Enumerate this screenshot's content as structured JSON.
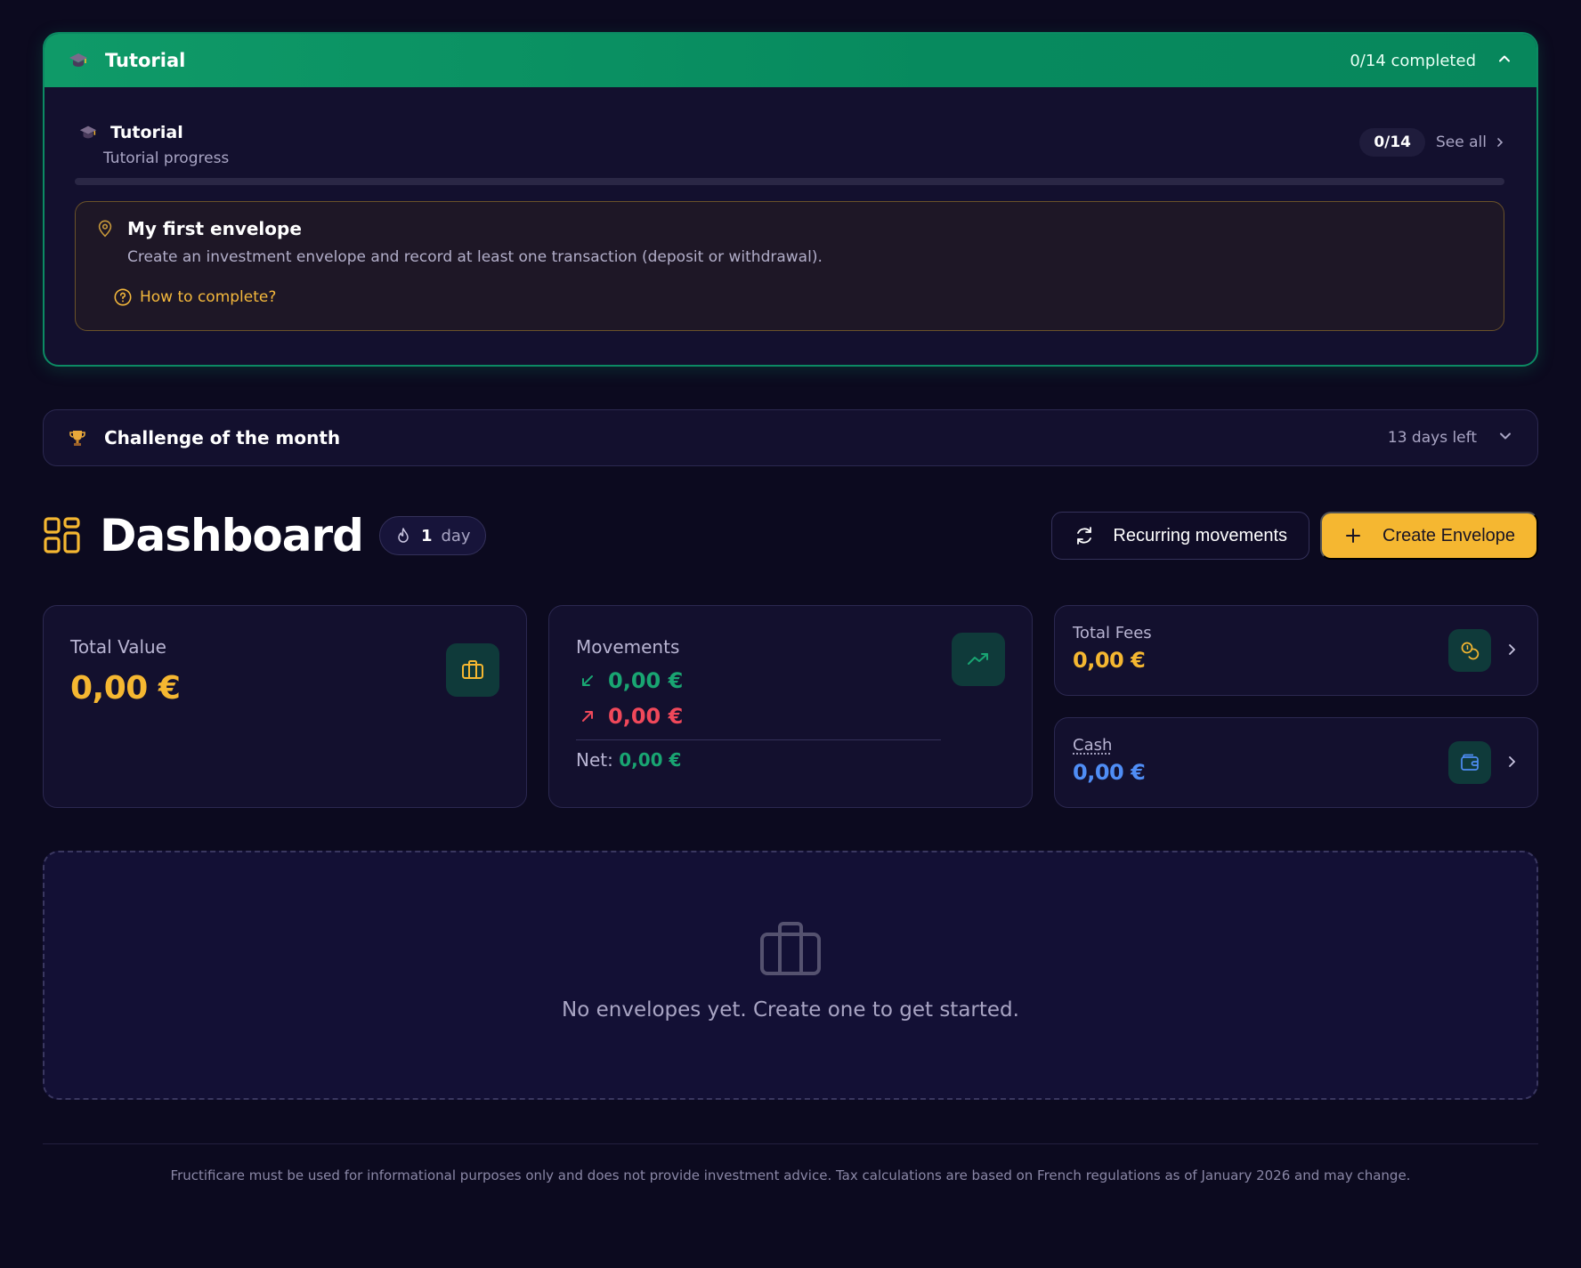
{
  "tutorial": {
    "header_title": "Tutorial",
    "header_count": "0/14 completed",
    "sub_title": "Tutorial",
    "sub_desc": "Tutorial progress",
    "count_pill": "0/14",
    "see_all": "See all",
    "progress": 0,
    "step": {
      "title": "My first envelope",
      "description": "Create an investment envelope and record at least one transaction (deposit or withdrawal).",
      "help_link": "How to complete?"
    }
  },
  "challenge": {
    "title": "Challenge of the month",
    "days_left": "13 days left"
  },
  "dashboard": {
    "title": "Dashboard",
    "streak_number": "1",
    "streak_unit": "day",
    "recurring_button": "Recurring movements",
    "create_button": "Create Envelope"
  },
  "cards": {
    "total_value": {
      "label": "Total Value",
      "amount": "0,00 €"
    },
    "movements": {
      "label": "Movements",
      "incoming": "0,00 €",
      "outgoing": "0,00 €",
      "net_label": "Net:",
      "net_value": "0,00 €"
    },
    "total_fees": {
      "label": "Total Fees",
      "amount": "0,00 €"
    },
    "cash": {
      "label": "Cash",
      "amount": "0,00 €"
    }
  },
  "empty_state": {
    "message": "No envelopes yet. Create one to get started."
  },
  "footer": {
    "disclaimer": "Fructificare must be used for informational purposes only and does not provide investment advice. Tax calculations are based on French regulations as of January 2026 and may change."
  },
  "colors": {
    "accent_green": "#0f9a68",
    "accent_yellow": "#f5b731",
    "positive": "#19a572",
    "negative": "#f0485a",
    "cash_blue": "#4f8df5"
  },
  "icons": {
    "tutorial": "graduation-cap-icon",
    "challenge": "trophy-icon",
    "dashboard": "grid-icon",
    "streak": "flame-icon",
    "recurring": "refresh-icon",
    "create": "plus-icon",
    "total_value": "briefcase-icon",
    "movements": "trending-up-icon",
    "fees": "coins-icon",
    "cash": "wallet-icon",
    "step": "map-pin-icon",
    "help": "question-circle-icon"
  }
}
